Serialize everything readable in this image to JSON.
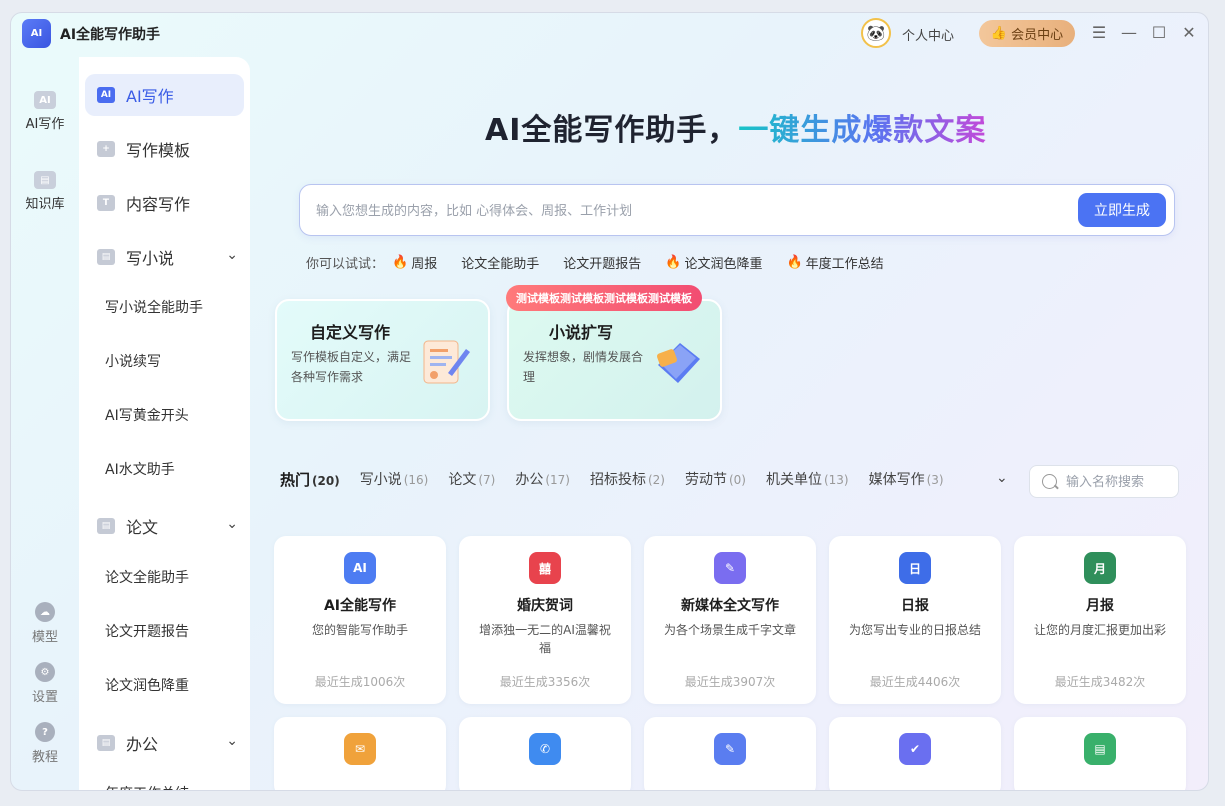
{
  "app": {
    "logo_text": "AI",
    "title": "AI全能写作助手"
  },
  "header": {
    "avatar_glyph": "🐼",
    "personal_center": "个人中心",
    "member_center": "会员中心",
    "member_icon": "👍"
  },
  "window_controls": {
    "menu": "☰",
    "minimize": "—",
    "maximize": "☐",
    "close": "✕"
  },
  "rail": {
    "top": [
      {
        "icon": "AI",
        "label": "AI写作"
      },
      {
        "icon": "▤",
        "label": "知识库"
      }
    ],
    "bottom": [
      {
        "icon": "☁",
        "label": "模型"
      },
      {
        "icon": "⚙",
        "label": "设置"
      },
      {
        "icon": "?",
        "label": "教程"
      }
    ]
  },
  "nav": {
    "items": [
      {
        "label": "AI写作",
        "icon": "AI"
      },
      {
        "label": "写作模板",
        "icon": "+"
      },
      {
        "label": "内容写作",
        "icon": "T"
      },
      {
        "label": "写小说",
        "icon": "▤"
      },
      {
        "label": "论文",
        "icon": "▤"
      },
      {
        "label": "办公",
        "icon": "▤"
      }
    ],
    "chevron": "⌄",
    "novel_subs": [
      "写小说全能助手",
      "小说续写",
      "AI写黄金开头",
      "AI水文助手"
    ],
    "paper_subs": [
      "论文全能助手",
      "论文开题报告",
      "论文润色降重"
    ],
    "office_subs": [
      "年度工作总结"
    ]
  },
  "hero": {
    "title_plain": "AI全能写作助手，",
    "title_accent": "一键生成爆款文案"
  },
  "search": {
    "placeholder": "输入您想生成的内容，比如 心得体会、周报、工作计划",
    "button": "立即生成"
  },
  "try": {
    "label": "你可以试试：",
    "fire": "🔥",
    "items": [
      "周报",
      "论文全能助手",
      "论文开题报告",
      "论文润色降重",
      "年度工作总结"
    ]
  },
  "features": [
    {
      "title": "自定义写作",
      "desc": "写作模板自定义，满足各种写作需求"
    },
    {
      "title": "小说扩写",
      "desc": "发挥想象，剧情发展合理",
      "badge": "测试模板测试模板测试模板测试模板"
    }
  ],
  "tabs": [
    {
      "label": "热门",
      "count": "(20)"
    },
    {
      "label": "写小说",
      "count": "(16)"
    },
    {
      "label": "论文",
      "count": "(7)"
    },
    {
      "label": "办公",
      "count": "(17)"
    },
    {
      "label": "招标投标",
      "count": "(2)"
    },
    {
      "label": "劳动节",
      "count": "(0)"
    },
    {
      "label": "机关单位",
      "count": "(13)"
    },
    {
      "label": "媒体写作",
      "count": "(3)"
    }
  ],
  "tabs_more": "⌄",
  "template_search": {
    "placeholder": "输入名称搜索"
  },
  "templates": [
    {
      "title": "AI全能写作",
      "desc": "您的智能写作助手",
      "meta": "最近生成1006次",
      "icon": "AI",
      "color": "#4d7cf2"
    },
    {
      "title": "婚庆贺词",
      "desc": "增添独一无二的AI温馨祝福",
      "meta": "最近生成3356次",
      "icon": "囍",
      "color": "#e8434d"
    },
    {
      "title": "新媒体全文写作",
      "desc": "为各个场景生成千字文章",
      "meta": "最近生成3907次",
      "icon": "✎",
      "color": "#7a6df0"
    },
    {
      "title": "日报",
      "desc": "为您写出专业的日报总结",
      "meta": "最近生成4406次",
      "icon": "日",
      "color": "#3e6de8"
    },
    {
      "title": "月报",
      "desc": "让您的月度汇报更加出彩",
      "meta": "最近生成3482次",
      "icon": "月",
      "color": "#2f8f5b"
    }
  ],
  "templates_row2_icons": [
    {
      "icon": "✉",
      "color": "#f0a23b"
    },
    {
      "icon": "✆",
      "color": "#3f8bf0"
    },
    {
      "icon": "✎",
      "color": "#5a7df0"
    },
    {
      "icon": "✔",
      "color": "#6a6ff0"
    },
    {
      "icon": "▤",
      "color": "#39b06b"
    }
  ]
}
